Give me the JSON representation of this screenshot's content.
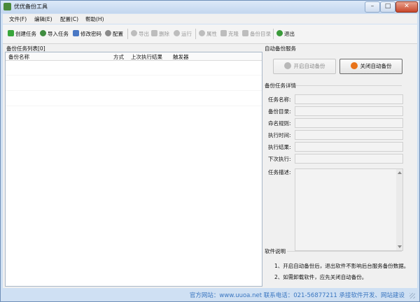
{
  "window": {
    "title": "优优备份工具",
    "minimize": "–",
    "maximize": "□",
    "close": "✕"
  },
  "menu": [
    "文件(F)",
    "编辑(E)",
    "配置(C)",
    "帮助(H)"
  ],
  "toolbar": {
    "create": "创建任务",
    "import": "导入任务",
    "change_password": "修改密码",
    "config": "配置",
    "export": "导出",
    "delete": "删除",
    "run": "运行",
    "properties": "属性",
    "clone": "克隆",
    "backup_dir": "备份目录",
    "exit": "退出"
  },
  "task_list": {
    "title": "备份任务列表[0]",
    "columns": [
      "备份名称",
      "方式",
      "上次执行结果",
      "触发器"
    ]
  },
  "auto_service": {
    "title": "自动备份服务",
    "start_label": "开启自动备份",
    "stop_label": "关闭自动备份"
  },
  "details": {
    "title": "备份任务详情",
    "fields": [
      "任务名称:",
      "备份目录:",
      "命名规则:",
      "执行时间:",
      "执行结果:",
      "下次执行:",
      "任务描述:"
    ]
  },
  "software_note": {
    "title": "软件说明",
    "lines": [
      "1、开启自动备份后，退出软件不影响后台服务备份数据。",
      "2、如需卸载软件，应先关闭自动备份。"
    ]
  },
  "status": {
    "text": "官方网站：www.uuoa.net 联系电话：021-56877211 承接软件开发、网站建设"
  },
  "colors": {
    "accent": "#3a76c0",
    "titlebar": "#c3d7ef",
    "stop_icon": "#e8731a"
  }
}
